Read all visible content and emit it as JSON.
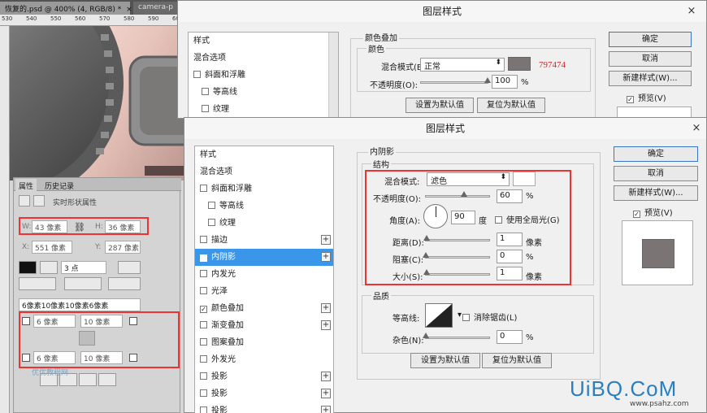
{
  "ps": {
    "tab_active": "恢复的.psd @ 400% (4, RGB/8) *",
    "tab_close": "×",
    "tab_other": "camera-p",
    "ruler": [
      "530",
      "540",
      "550",
      "560",
      "570",
      "580",
      "590",
      "600"
    ]
  },
  "props": {
    "tab_properties": "属性",
    "tab_history": "历史记录",
    "header": "实时形状属性",
    "w_label": "W:",
    "w_value": "43 像素",
    "h_label": "H:",
    "h_value": "36 像素",
    "x_label": "X:",
    "x_value": "551 像素",
    "y_label": "Y:",
    "y_value": "287 像素",
    "stroke_width": "3 点",
    "corners_summary": "6像素10像素10像素6像素",
    "corner_tl": "6 像素",
    "corner_tr": "10 像素",
    "corner_bl": "6 像素",
    "corner_br": "10 像素"
  },
  "dialog_back": {
    "title": "图层样式",
    "close": "×",
    "list": [
      {
        "label": "样式"
      },
      {
        "label": "混合选项"
      },
      {
        "label": "斜面和浮雕",
        "check": true
      },
      {
        "label": "等高线",
        "check": true,
        "sub": true
      },
      {
        "label": "纹理",
        "check": true,
        "sub": true
      }
    ],
    "section_title": "颜色叠加",
    "group_color": "颜色",
    "blend_mode_label": "混合模式(B):",
    "blend_mode_value": "正常",
    "hex": "797474",
    "opacity_label": "不透明度(O):",
    "opacity_value": "100",
    "opacity_unit": "%",
    "btn_set_default": "设置为默认值",
    "btn_reset_default": "复位为默认值",
    "ok": "确定",
    "cancel": "取消",
    "new_style": "新建样式(W)...",
    "preview": "预览(V)"
  },
  "dialog_front": {
    "title": "图层样式",
    "close": "×",
    "list": [
      {
        "label": "样式"
      },
      {
        "label": "混合选项"
      },
      {
        "label": "斜面和浮雕",
        "check": true
      },
      {
        "label": "等高线",
        "check": true,
        "sub": true
      },
      {
        "label": "纹理",
        "check": true,
        "sub": true
      },
      {
        "label": "描边",
        "check": true,
        "plus": true
      },
      {
        "label": "内阴影",
        "check": true,
        "checked": true,
        "plus": true,
        "selected": true
      },
      {
        "label": "内发光",
        "check": true
      },
      {
        "label": "光泽",
        "check": true
      },
      {
        "label": "颜色叠加",
        "check": true,
        "checked": true,
        "plus": true
      },
      {
        "label": "渐变叠加",
        "check": true,
        "plus": true
      },
      {
        "label": "图案叠加",
        "check": true
      },
      {
        "label": "外发光",
        "check": true
      },
      {
        "label": "投影",
        "check": true,
        "plus": true
      },
      {
        "label": "投影",
        "check": true,
        "plus": true
      },
      {
        "label": "投影",
        "check": true,
        "plus": true
      }
    ],
    "section_title": "内阴影",
    "group_structure": "结构",
    "blend_mode_label": "混合模式:",
    "blend_mode_value": "滤色",
    "opacity_label": "不透明度(O):",
    "opacity_value": "60",
    "opacity_unit": "%",
    "angle_label": "角度(A):",
    "angle_value": "90",
    "angle_unit": "度",
    "global_light": "使用全局光(G)",
    "distance_label": "距离(D):",
    "distance_value": "1",
    "distance_unit": "像素",
    "choke_label": "阻塞(C):",
    "choke_value": "0",
    "choke_unit": "%",
    "size_label": "大小(S):",
    "size_value": "1",
    "size_unit": "像素",
    "group_quality": "品质",
    "contour_label": "等高线:",
    "antialias": "消除锯齿(L)",
    "noise_label": "杂色(N):",
    "noise_value": "0",
    "noise_unit": "%",
    "btn_set_default": "设置为默认值",
    "btn_reset_default": "复位为默认值",
    "ok": "确定",
    "cancel": "取消",
    "new_style": "新建样式(W)...",
    "preview": "预览(V)",
    "check_mark": "✓"
  },
  "watermark": {
    "text": "UiBQ.CoM",
    "url": "www.psahz.com",
    "small": "优优教程网"
  },
  "colors": {
    "accent_selection": "#3a96e8",
    "highlight_red": "#e33333",
    "hex_text": "#d02020",
    "shadow_swatch": "#797474"
  },
  "levels": {
    "back_opacity": 1.0,
    "front_opacity": 0.6,
    "front_distance": 0.01,
    "front_choke": 0.0,
    "front_size": 0.01,
    "front_noise": 0.0
  }
}
